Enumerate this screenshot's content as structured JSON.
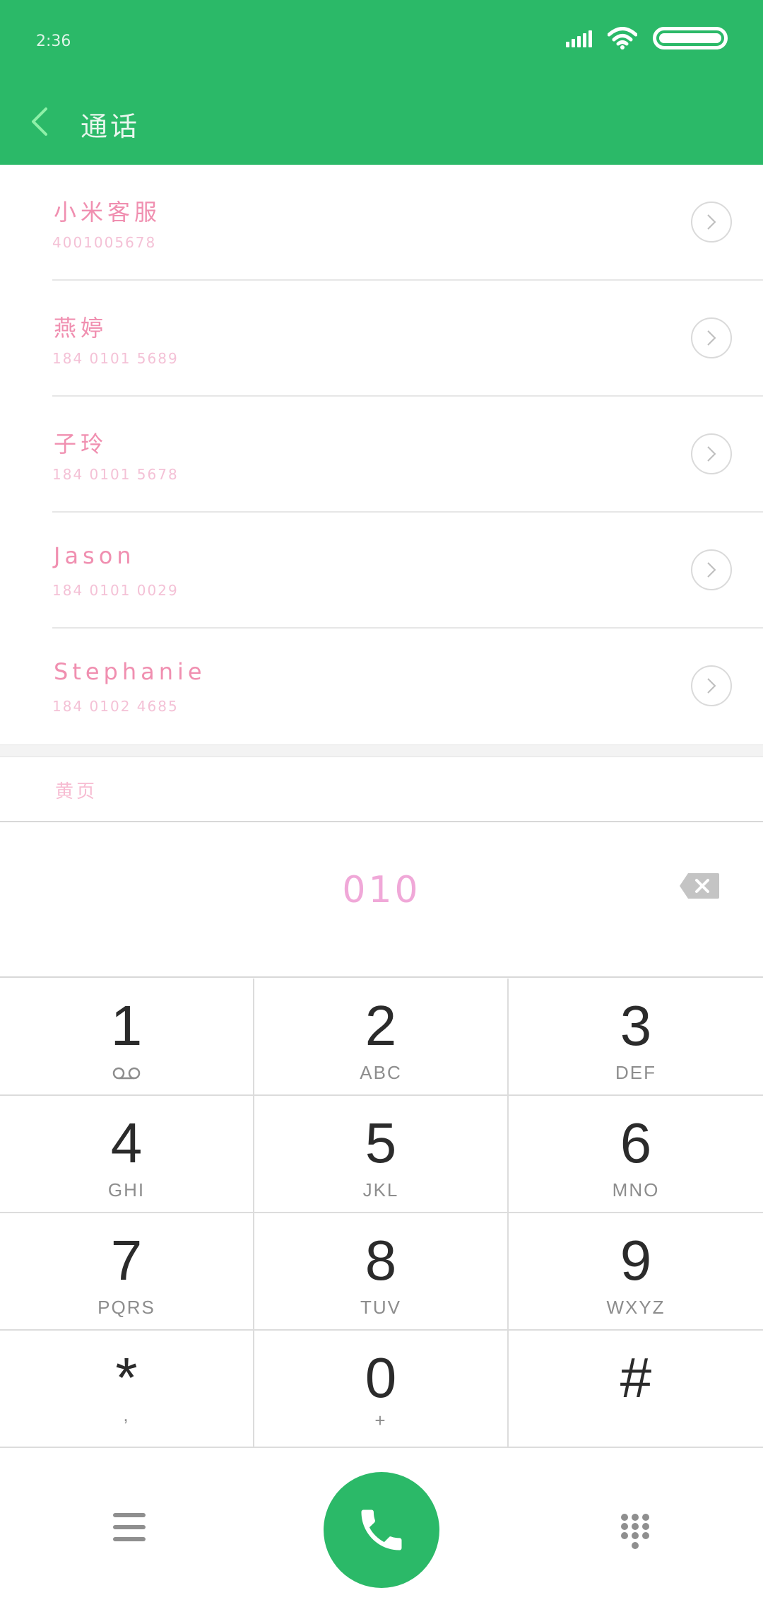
{
  "status_bar": {
    "time": "2:36"
  },
  "header": {
    "title": "通话"
  },
  "contacts": [
    {
      "name": "小米客服",
      "number": "4001005678"
    },
    {
      "name": "燕婷",
      "number": "184 0101 5689"
    },
    {
      "name": "子玲",
      "number": "184 0101 5678"
    },
    {
      "name": "Jason",
      "number": "184 0101 0029"
    },
    {
      "name": "Stephanie",
      "number": "184 0102 4685"
    }
  ],
  "yellow_pages": {
    "label": "黄页"
  },
  "dial": {
    "dialed_number": "010"
  },
  "keypad": [
    {
      "digit": "1",
      "letters": ""
    },
    {
      "digit": "2",
      "letters": "ABC"
    },
    {
      "digit": "3",
      "letters": "DEF"
    },
    {
      "digit": "4",
      "letters": "GHI"
    },
    {
      "digit": "5",
      "letters": "JKL"
    },
    {
      "digit": "6",
      "letters": "MNO"
    },
    {
      "digit": "7",
      "letters": "PQRS"
    },
    {
      "digit": "8",
      "letters": "TUV"
    },
    {
      "digit": "9",
      "letters": "WXYZ"
    },
    {
      "digit": "*",
      "letters": ","
    },
    {
      "digit": "0",
      "letters": "+"
    },
    {
      "digit": "#",
      "letters": ""
    }
  ],
  "icons": {
    "back": "chevron-left-icon",
    "contact_detail": "chevron-right-circle-icon",
    "backspace": "backspace-icon",
    "voicemail": "voicemail-icon",
    "menu": "menu-icon",
    "call": "phone-icon",
    "dialpad": "dialpad-icon"
  },
  "colors": {
    "accent": "#2bb968",
    "contact_name": "#f08fb0",
    "contact_number": "#f4c1d6",
    "dialed_number": "#f0a8d8"
  }
}
